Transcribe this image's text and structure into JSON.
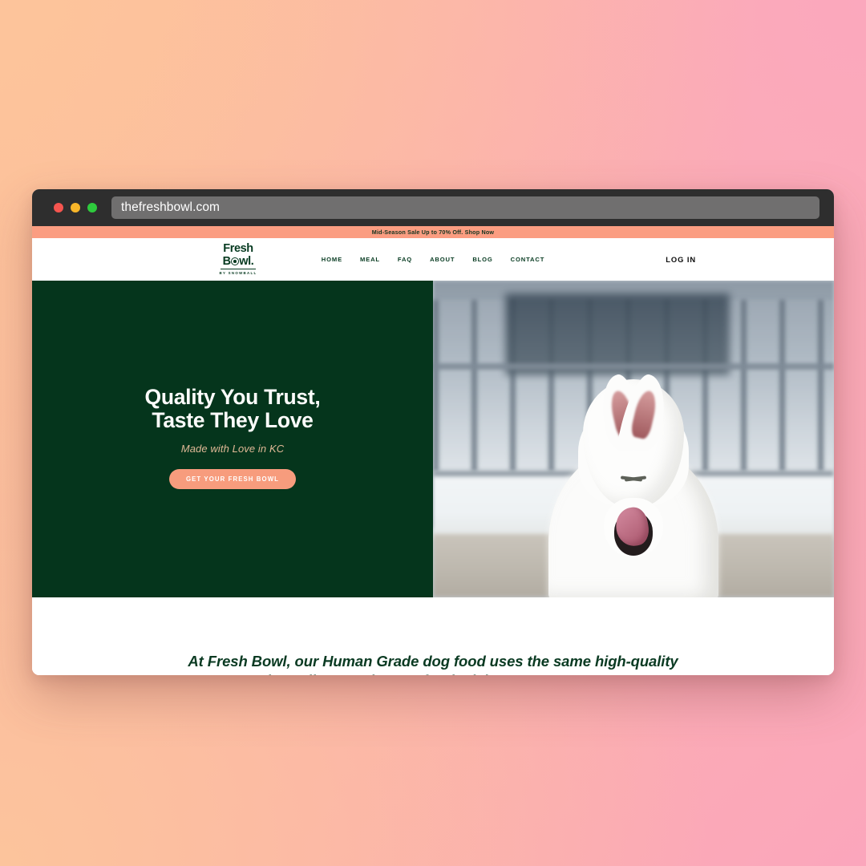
{
  "background": {
    "gradient_from": "#fcc098",
    "gradient_to": "#fba6bc"
  },
  "browser": {
    "url": "thefreshbowl.com",
    "traffic_lights": [
      {
        "name": "close",
        "color": "#f5554f"
      },
      {
        "name": "minimize",
        "color": "#f8b629"
      },
      {
        "name": "maximize",
        "color": "#2ecb3d"
      }
    ]
  },
  "site": {
    "announcement": "Mid-Season Sale Up to 70% Off. Shop Now",
    "logo": {
      "line1": "Fresh",
      "line2a": "B",
      "line2b": "wl",
      "dot": ".",
      "tagline": "BY SNOWBALL"
    },
    "nav": [
      {
        "label": "HOME"
      },
      {
        "label": "MEAL"
      },
      {
        "label": "FAQ"
      },
      {
        "label": "ABOUT"
      },
      {
        "label": "BLOG"
      },
      {
        "label": "CONTACT"
      }
    ],
    "login_label": "LOG IN",
    "hero": {
      "headline_line1": "Quality You Trust,",
      "headline_line2": "Taste They Love",
      "subtitle": "Made with Love in KC",
      "cta_label": "GET YOUR FRESH BOWL",
      "panel_color": "#05351c",
      "cta_color": "#f79c7d",
      "image_alt": "white-shepherd-dog-licking-nose-in-front-of-fence"
    },
    "lower_section": {
      "paragraph_line1": "At Fresh Bowl, our Human Grade dog food uses the same",
      "paragraph_line2": "high-quality ingredients as human food, giving your pet top-"
    }
  }
}
